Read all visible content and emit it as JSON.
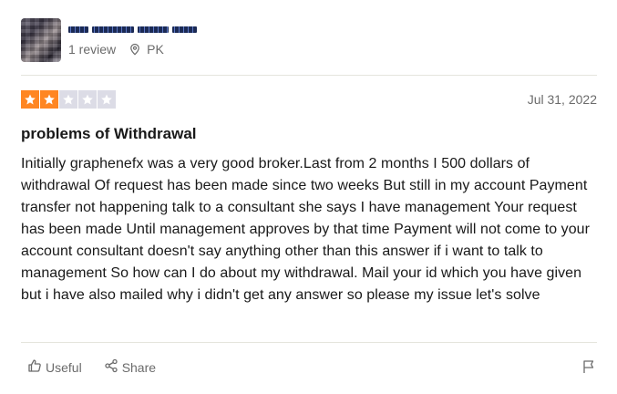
{
  "reviewer": {
    "review_count": "1 review",
    "location": "PK"
  },
  "review": {
    "rating": 2,
    "max_rating": 5,
    "date": "Jul 31, 2022",
    "title": "problems of Withdrawal",
    "body": "Initially graphenefx was a very good broker.Last from 2 months I 500 dollars of withdrawal Of request has been made since two weeks But still in my account Payment transfer not happening talk to a consultant she says I have management Your request has been made Until management approves by that time Payment will not come to your account consultant doesn't say anything other than this answer if i want to talk to management So how can I do about my withdrawal. Mail your id which you have given but i have also mailed why i didn't get any answer so please my issue let's solve"
  },
  "actions": {
    "useful_label": "Useful",
    "share_label": "Share"
  },
  "colors": {
    "star_filled": "#ff8622",
    "star_empty": "#dcdce6",
    "muted_text": "#6b6b6b",
    "divider": "#e5e5dd"
  },
  "icons": {
    "location": "map-pin-icon",
    "useful": "thumbs-up-icon",
    "share": "share-icon",
    "report": "flag-icon"
  }
}
